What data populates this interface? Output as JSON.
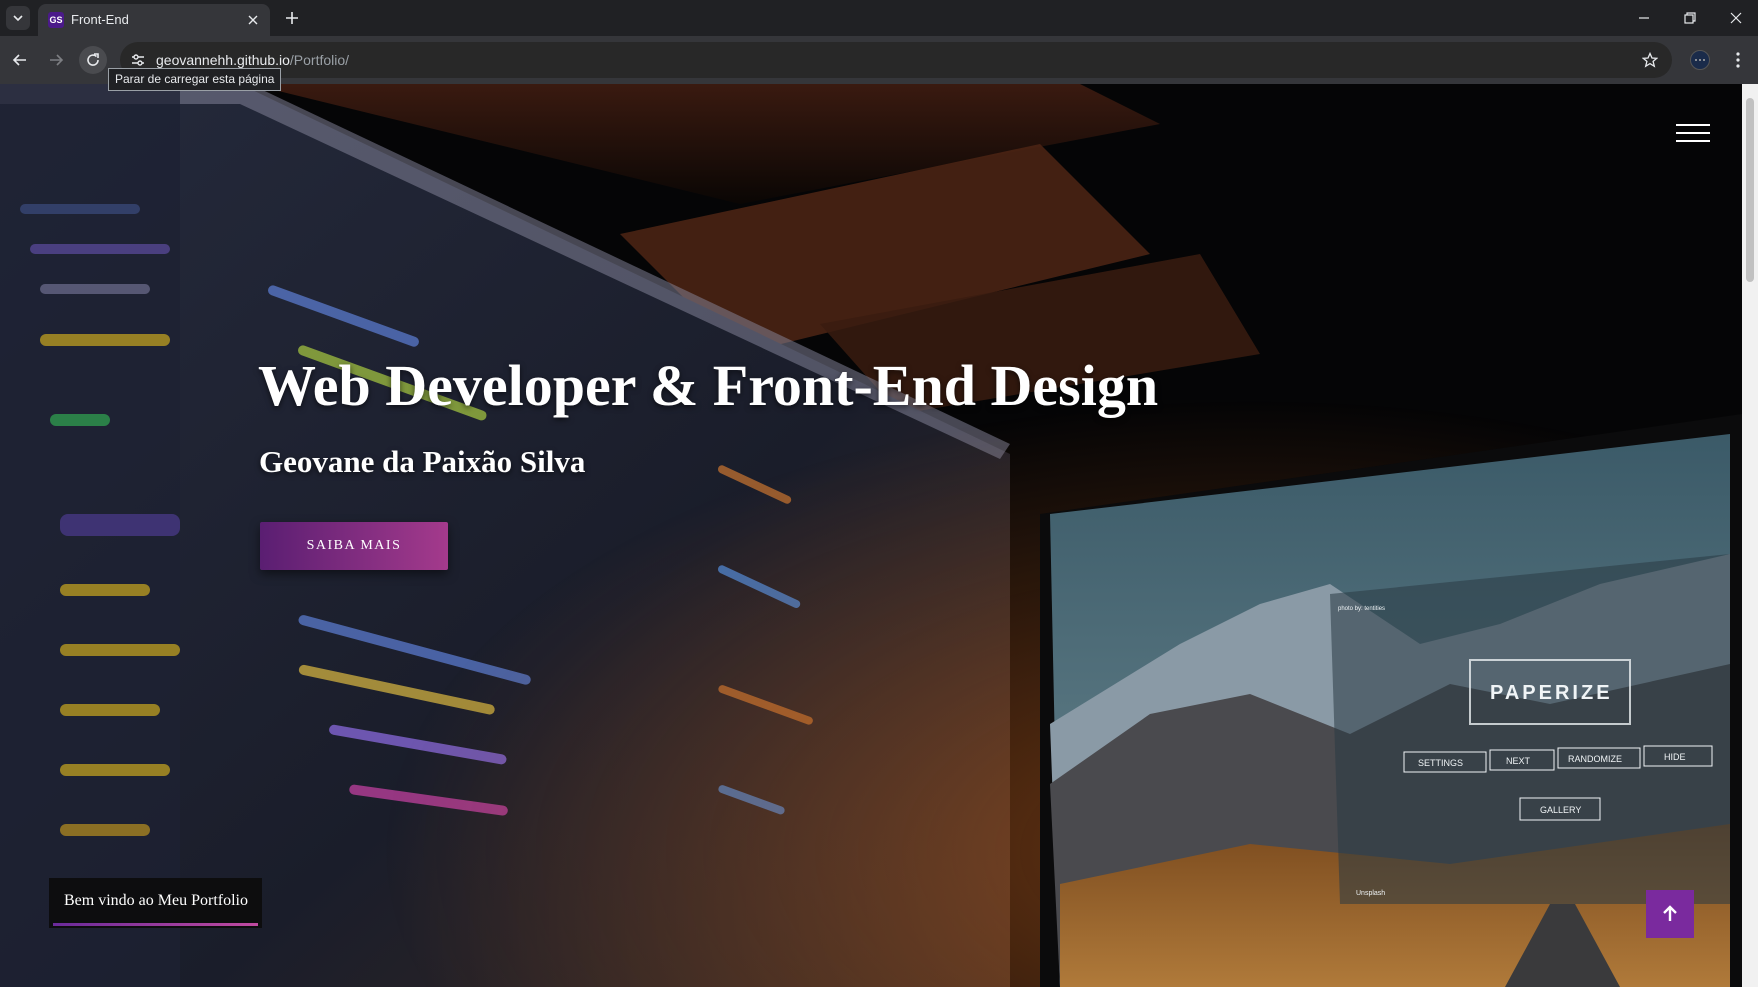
{
  "browser": {
    "tab": {
      "favicon_text": "GS",
      "title": "Front-End"
    },
    "url": {
      "host": "geovannehh.github.io",
      "path": "/Portfolio/"
    },
    "tooltip": "Parar de carregar esta página"
  },
  "page": {
    "hero_title": "Web Developer & Front-End Design",
    "hero_subtitle": "Geovane da Paixão Silva",
    "cta_label": "SAIBA MAIS",
    "welcome_text": "Bem vindo ao Meu Portfolio",
    "background_screen_text": {
      "brand": "PAPERIZE",
      "buttons": [
        "SETTINGS",
        "NEXT",
        "RANDOMIZE",
        "HIDE"
      ],
      "gallery": "GALLERY",
      "photo_credit": "photo by: tentities",
      "unsplash": "Unsplash"
    }
  },
  "colors": {
    "accent_start": "#5a1e72",
    "accent_end": "#a43a8c",
    "to_top_bg": "#7a2a9e"
  }
}
